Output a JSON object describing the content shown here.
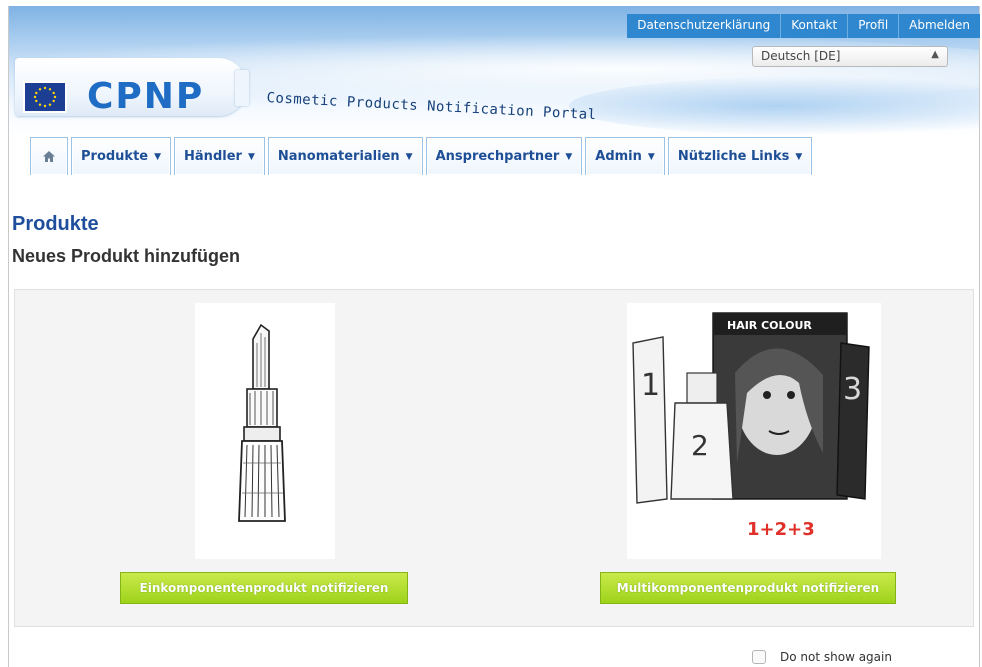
{
  "header": {
    "logo": "CPNP",
    "tagline": "Cosmetic Products Notification Portal",
    "top_links": [
      "Datenschutzerklärung",
      "Kontakt",
      "Profil",
      "Abmelden"
    ],
    "language": "Deutsch [DE]"
  },
  "nav": {
    "items": [
      {
        "label": "Produkte"
      },
      {
        "label": "Händler"
      },
      {
        "label": "Nanomaterialien"
      },
      {
        "label": "Ansprechpartner"
      },
      {
        "label": "Admin"
      },
      {
        "label": "Nützliche Links"
      }
    ]
  },
  "main": {
    "title": "Produkte",
    "subtitle": "Neues Produkt hinzufügen",
    "single_button": "Einkomponentenprodukt notifizieren",
    "multi_button": "Multikomponentenprodukt notifizieren",
    "multi_image_text": {
      "box_label": "HAIR COLOUR",
      "n1": "1",
      "n2": "2",
      "n3": "3",
      "caption": "1+2+3"
    },
    "dont_show_label": "Do not show again"
  },
  "colors": {
    "nav_text": "#1e4f96",
    "title": "#1f4f9c",
    "button": "#9fd21b",
    "toplinks_bg": "#2f87cf"
  }
}
